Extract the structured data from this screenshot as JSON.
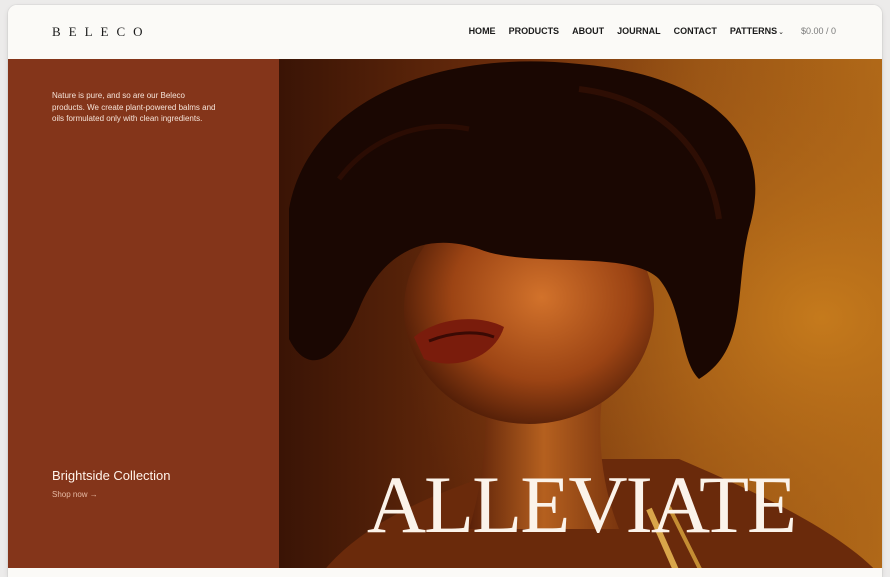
{
  "brand": {
    "logo": "BELECO"
  },
  "nav": {
    "home": "HOME",
    "products": "PRODUCTS",
    "about": "ABOUT",
    "journal": "JOURNAL",
    "contact": "CONTACT",
    "patterns": "PATTERNS",
    "cart": "$0.00 / 0"
  },
  "hero": {
    "intro": "Nature is pure, and so are our Beleco products. We create plant-powered balms and oils formulated only with clean ingredients.",
    "collection_title": "Brightside Collection",
    "shop_link": "Shop now →",
    "headline": "ALLEVIATE"
  },
  "colors": {
    "panel": "#84351a",
    "header_bg": "#fbfaf7",
    "headline": "#fbf3ea"
  },
  "icons": {
    "dropdown": "chevron-down-icon"
  }
}
